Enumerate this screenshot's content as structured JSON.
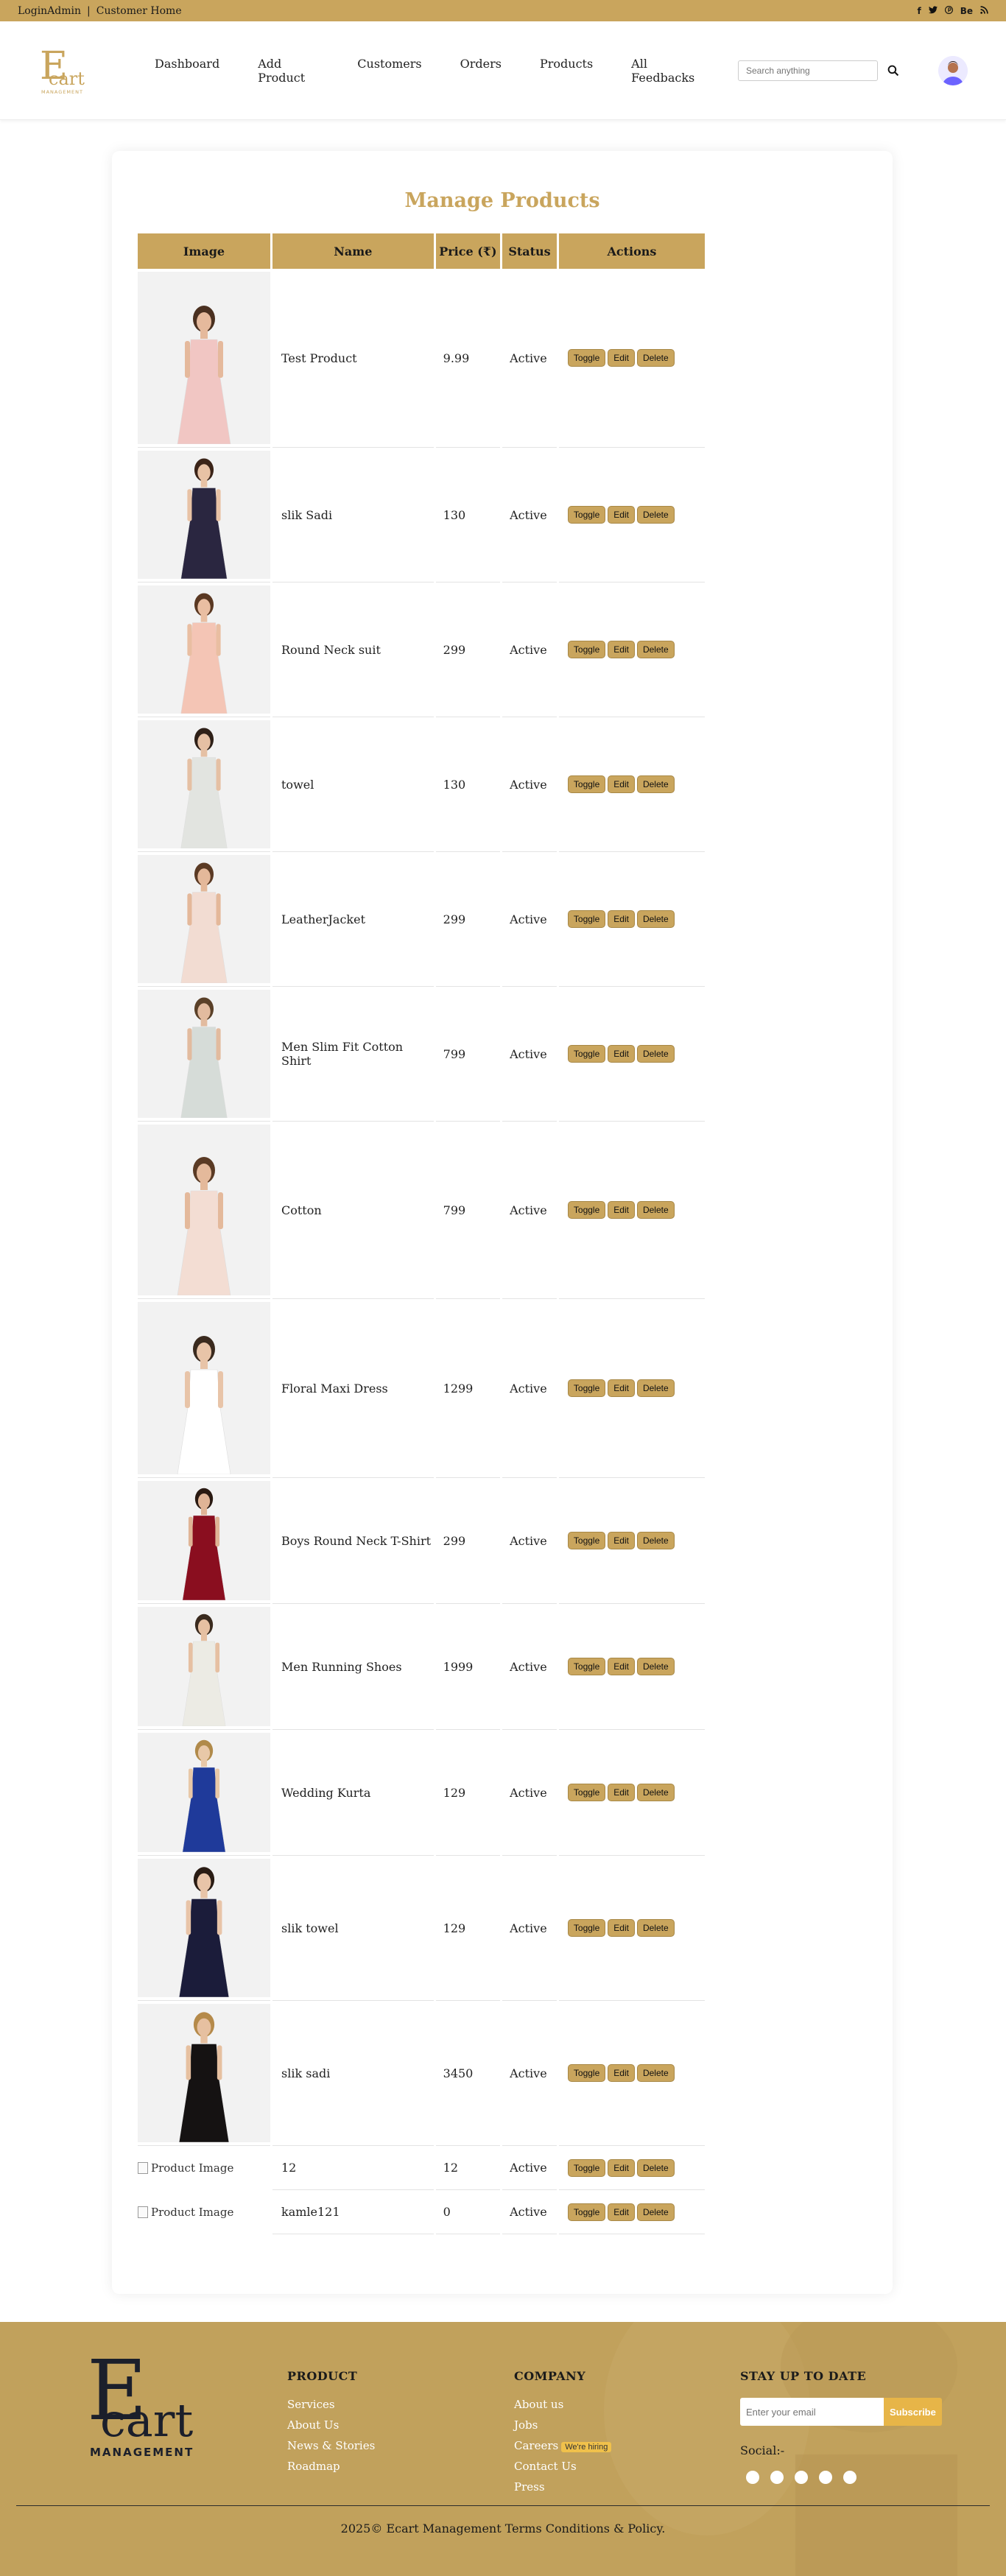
{
  "topbar": {
    "login_label": "LoginAdmin",
    "separator": "|",
    "customer_home": "Customer Home",
    "social": [
      "f",
      "t",
      "p",
      "Be",
      "rss"
    ]
  },
  "header": {
    "brand_big": "E",
    "brand_small": "cart",
    "brand_sub": "MANAGEMENT",
    "nav": [
      "Dashboard",
      "Add Product",
      "Customers",
      "Orders",
      "Products",
      "All Feedbacks"
    ],
    "search_placeholder": "Search anything"
  },
  "page": {
    "title": "Manage Products"
  },
  "table": {
    "headers": [
      "Image",
      "Name",
      "Price (₹)",
      "Status",
      "Actions"
    ],
    "actions": {
      "toggle": "Toggle",
      "edit": "Edit",
      "delete": "Delete"
    },
    "broken_image_alt": "Product Image",
    "rows": [
      {
        "name": "Test Product",
        "price": "9.99",
        "status": "Active",
        "dress": "#f1c6c3",
        "skin": "#e5b99c",
        "hair": "#4a3020"
      },
      {
        "name": "slik Sadi",
        "price": "130",
        "status": "Active",
        "dress": "#2a2640",
        "skin": "#e8c2a5",
        "hair": "#3b2418"
      },
      {
        "name": "Round Neck suit",
        "price": "299",
        "status": "Active",
        "dress": "#f4c5b5",
        "skin": "#e9bea2",
        "hair": "#5a3822"
      },
      {
        "name": "towel",
        "price": "130",
        "status": "Active",
        "dress": "#e2e4e0",
        "skin": "#e5c0a4",
        "hair": "#2e2018"
      },
      {
        "name": "LeatherJacket",
        "price": "299",
        "status": "Active",
        "dress": "#f2dcd2",
        "skin": "#e4b89a",
        "hair": "#5b3a24"
      },
      {
        "name": "Men Slim Fit Cotton Shirt",
        "price": "799",
        "status": "Active",
        "dress": "#d6dcd8",
        "skin": "#e2bb9f",
        "hair": "#5a4028"
      },
      {
        "name": "Cotton",
        "price": "799",
        "status": "Active",
        "dress": "#f3ddd3",
        "skin": "#e4b99b",
        "hair": "#5a3a24"
      },
      {
        "name": "Floral Maxi Dress",
        "price": "1299",
        "status": "Active",
        "dress": "#ffffff",
        "skin": "#e8c4a8",
        "hair": "#3a2a1e"
      },
      {
        "name": "Boys Round Neck T-Shirt",
        "price": "299",
        "status": "Active",
        "dress": "#8a0e1f",
        "skin": "#e0b496",
        "hair": "#2a1a12"
      },
      {
        "name": "Men Running Shoes",
        "price": "1999",
        "status": "Active",
        "dress": "#ecebe4",
        "skin": "#e6c0a2",
        "hair": "#3a2a1e"
      },
      {
        "name": "Wedding Kurta",
        "price": "129",
        "status": "Active",
        "dress": "#1f3a9a",
        "skin": "#e8c8a8",
        "hair": "#b08a4a"
      },
      {
        "name": "slik towel",
        "price": "129",
        "status": "Active",
        "dress": "#1b1c3a",
        "skin": "#e8c4a8",
        "hair": "#2a1c14"
      },
      {
        "name": "slik sadi",
        "price": "3450",
        "status": "Active",
        "dress": "#151212",
        "skin": "#e6c0a0",
        "hair": "#b58a4a"
      }
    ],
    "broken_rows": [
      {
        "name": "12",
        "price": "12",
        "status": "Active"
      },
      {
        "name": "kamle121",
        "price": "0",
        "status": "Active"
      }
    ]
  },
  "footer": {
    "brand_big": "E",
    "brand_small": "cart",
    "brand_sub": "MANAGEMENT",
    "product_heading": "PRODUCT",
    "product_links": [
      "Services",
      "About Us",
      "News & Stories",
      "Roadmap"
    ],
    "company_heading": "COMPANY",
    "company_links": [
      "About us",
      "Jobs",
      "Careers",
      "Contact Us",
      "Press"
    ],
    "hiring_badge": "We're hiring",
    "newsletter_heading": "STAY UP TO DATE",
    "email_placeholder": "Enter your email",
    "subscribe_label": "Subscribe",
    "social_label": "Social:-",
    "copyright": "2025© Ecart Management Terms Conditions & Policy."
  },
  "colors": {
    "gold": "#c9a55d",
    "footer_bg": "#c1a15c",
    "subscribe": "#e7b548"
  }
}
